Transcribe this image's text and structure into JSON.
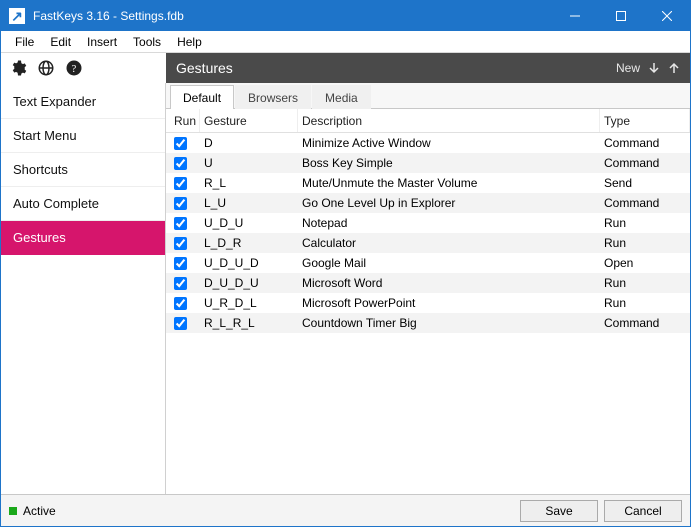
{
  "window": {
    "title": "FastKeys 3.16  - Settings.fdb"
  },
  "menus": {
    "file": "File",
    "edit": "Edit",
    "insert": "Insert",
    "tools": "Tools",
    "help": "Help"
  },
  "header": {
    "title": "Gestures",
    "new_label": "New"
  },
  "sidebar": {
    "items": [
      "Text Expander",
      "Start Menu",
      "Shortcuts",
      "Auto Complete",
      "Gestures"
    ],
    "active_index": 4
  },
  "tabs": {
    "items": [
      "Default",
      "Browsers",
      "Media"
    ],
    "active_index": 0
  },
  "columns": {
    "run": "Run",
    "gesture": "Gesture",
    "description": "Description",
    "type": "Type"
  },
  "rows": [
    {
      "run": true,
      "gesture": "D",
      "description": "Minimize Active Window",
      "type": "Command"
    },
    {
      "run": true,
      "gesture": "U",
      "description": "Boss Key Simple",
      "type": "Command"
    },
    {
      "run": true,
      "gesture": "R_L",
      "description": "Mute/Unmute the Master Volume",
      "type": "Send"
    },
    {
      "run": true,
      "gesture": "L_U",
      "description": "Go One Level Up in Explorer",
      "type": "Command"
    },
    {
      "run": true,
      "gesture": "U_D_U",
      "description": "Notepad",
      "type": "Run"
    },
    {
      "run": true,
      "gesture": "L_D_R",
      "description": "Calculator",
      "type": "Run"
    },
    {
      "run": true,
      "gesture": "U_D_U_D",
      "description": "Google Mail",
      "type": "Open"
    },
    {
      "run": true,
      "gesture": "D_U_D_U",
      "description": "Microsoft Word",
      "type": "Run"
    },
    {
      "run": true,
      "gesture": "U_R_D_L",
      "description": "Microsoft PowerPoint",
      "type": "Run"
    },
    {
      "run": true,
      "gesture": "R_L_R_L",
      "description": "Countdown Timer Big",
      "type": "Command"
    }
  ],
  "footer": {
    "status": "Active",
    "save": "Save",
    "cancel": "Cancel"
  }
}
